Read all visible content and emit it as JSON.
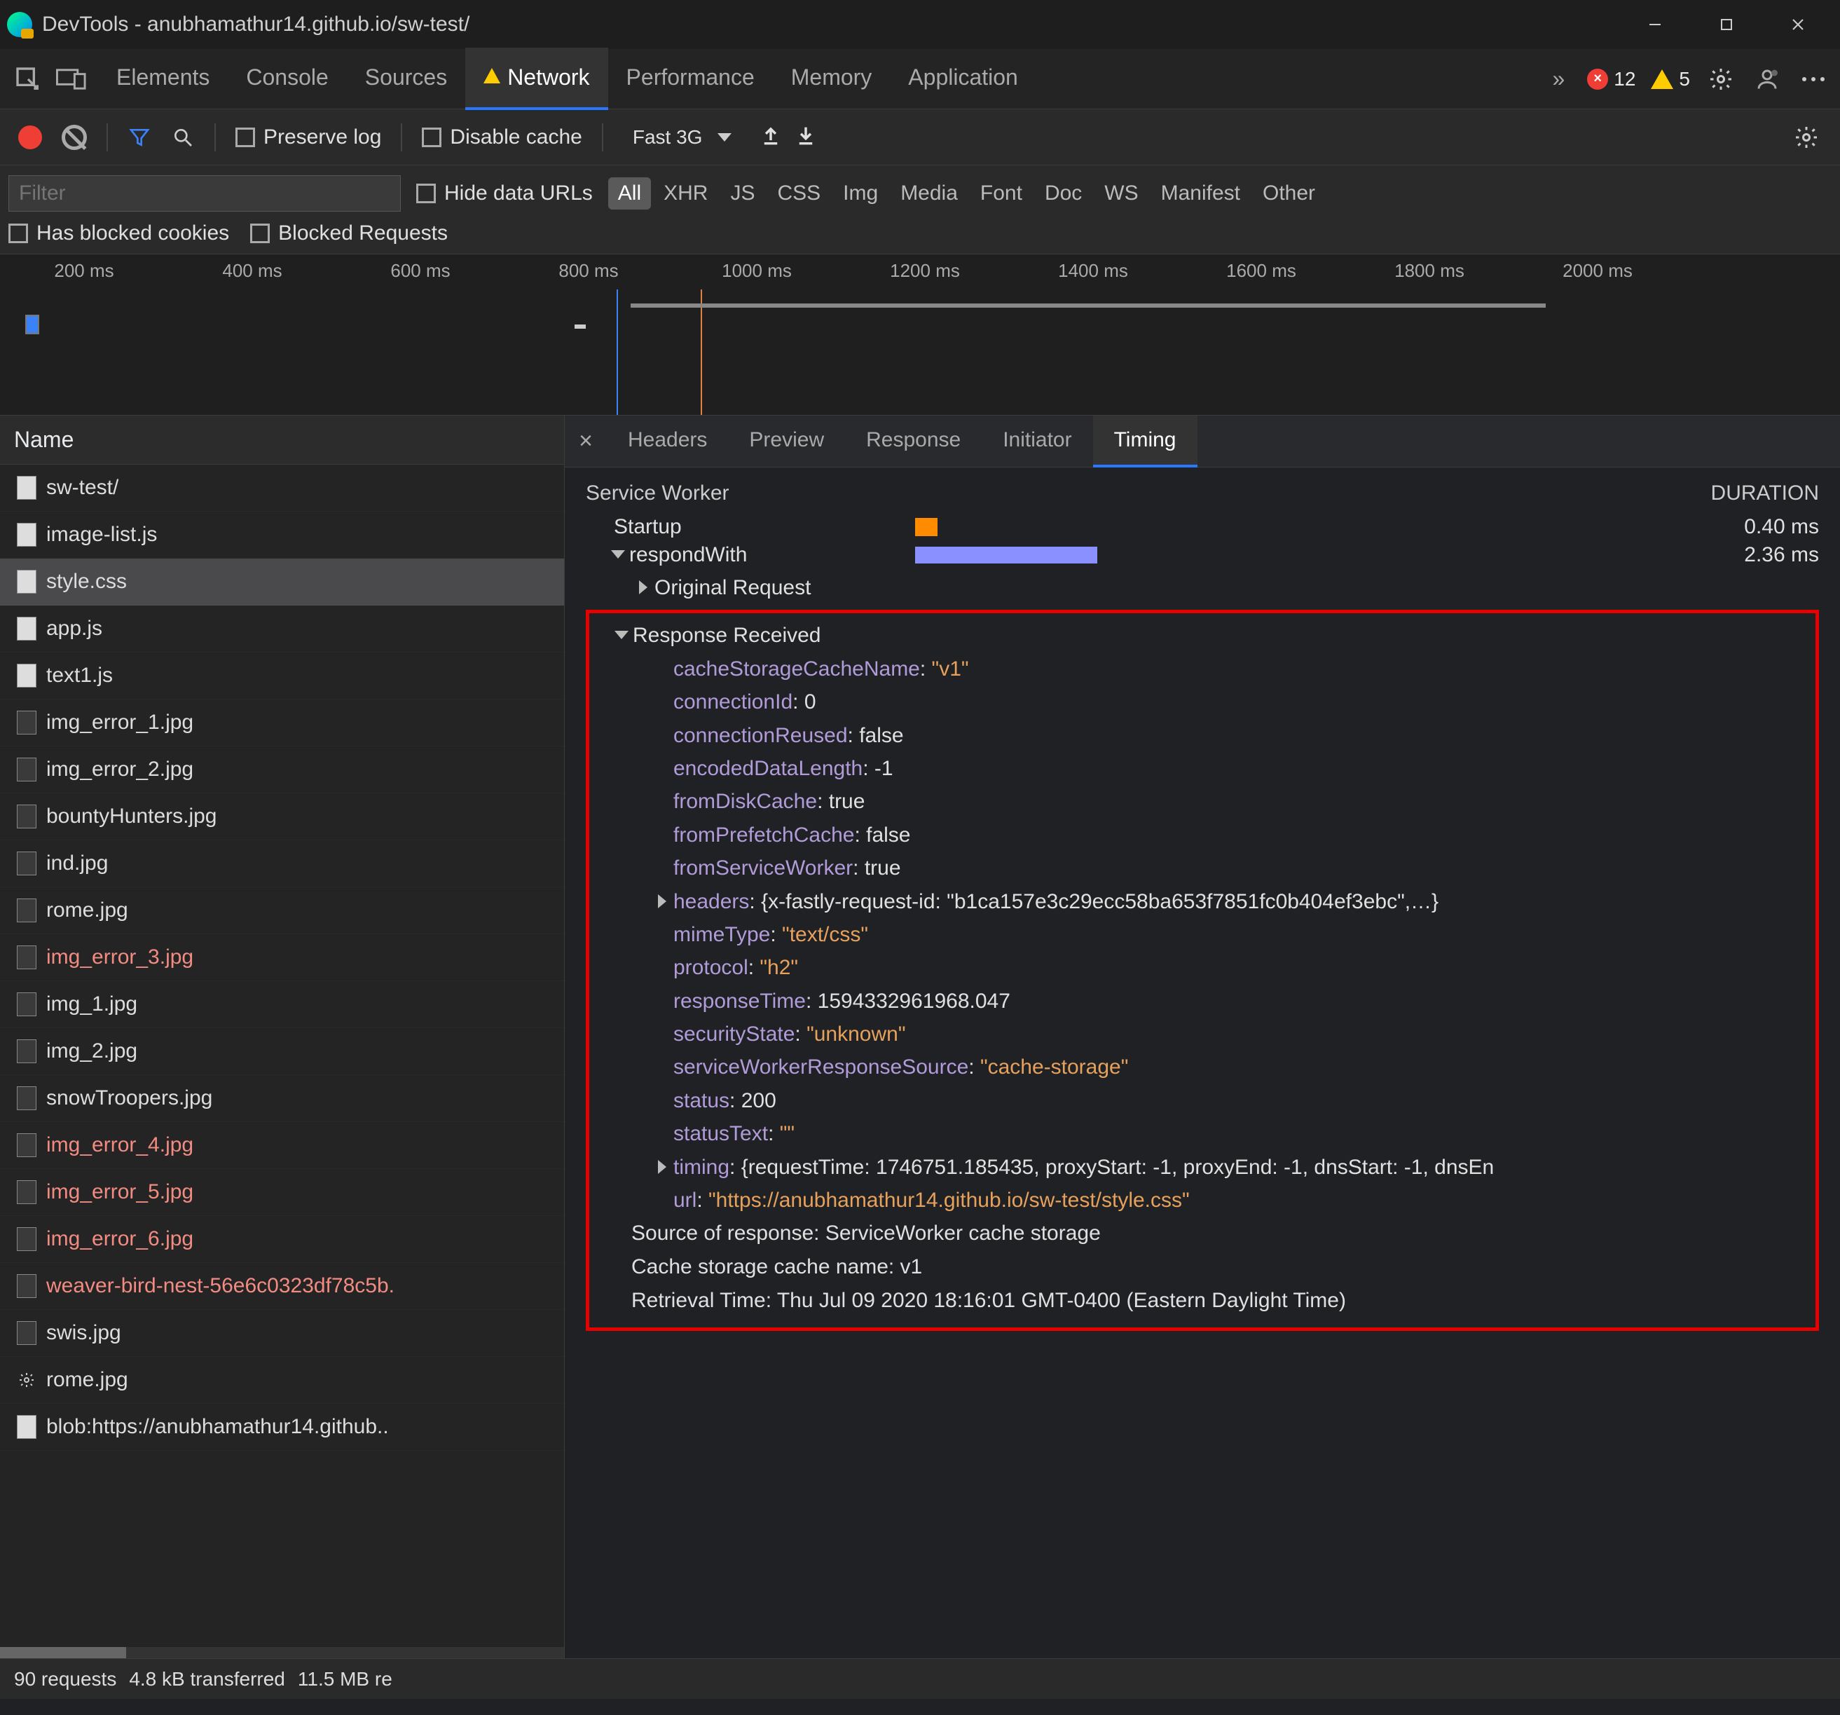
{
  "window": {
    "title": "DevTools - anubhamathur14.github.io/sw-test/"
  },
  "mainTabs": {
    "items": [
      "Elements",
      "Console",
      "Sources",
      "Network",
      "Performance",
      "Memory",
      "Application"
    ],
    "activeIndex": 3,
    "overflow": "»",
    "errors": "12",
    "warnings": "5"
  },
  "toolbar": {
    "preserveLog": "Preserve log",
    "disableCache": "Disable cache",
    "throttling": "Fast 3G"
  },
  "filterbar": {
    "placeholder": "Filter",
    "hideDataUrls": "Hide data URLs",
    "types": [
      "All",
      "XHR",
      "JS",
      "CSS",
      "Img",
      "Media",
      "Font",
      "Doc",
      "WS",
      "Manifest",
      "Other"
    ],
    "activeTypeIndex": 0,
    "hasBlockedCookies": "Has blocked cookies",
    "blockedRequests": "Blocked Requests"
  },
  "timeline": {
    "ticks": [
      "200 ms",
      "400 ms",
      "600 ms",
      "800 ms",
      "1000 ms",
      "1200 ms",
      "1400 ms",
      "1600 ms",
      "1800 ms",
      "2000 ms"
    ]
  },
  "requestList": {
    "header": "Name",
    "selectedIndex": 2,
    "items": [
      {
        "name": "sw-test/",
        "kind": "doc"
      },
      {
        "name": "image-list.js",
        "kind": "doc"
      },
      {
        "name": "style.css",
        "kind": "doc"
      },
      {
        "name": "app.js",
        "kind": "doc"
      },
      {
        "name": "text1.js",
        "kind": "doc"
      },
      {
        "name": "img_error_1.jpg",
        "kind": "img"
      },
      {
        "name": "img_error_2.jpg",
        "kind": "img"
      },
      {
        "name": "bountyHunters.jpg",
        "kind": "img"
      },
      {
        "name": "ind.jpg",
        "kind": "img"
      },
      {
        "name": "rome.jpg",
        "kind": "img"
      },
      {
        "name": "img_error_3.jpg",
        "kind": "img",
        "err": true
      },
      {
        "name": "img_1.jpg",
        "kind": "img"
      },
      {
        "name": "img_2.jpg",
        "kind": "img"
      },
      {
        "name": "snowTroopers.jpg",
        "kind": "img"
      },
      {
        "name": "img_error_4.jpg",
        "kind": "img",
        "err": true
      },
      {
        "name": "img_error_5.jpg",
        "kind": "img",
        "err": true
      },
      {
        "name": "img_error_6.jpg",
        "kind": "img",
        "err": true
      },
      {
        "name": "weaver-bird-nest-56e6c0323df78c5b.",
        "kind": "img",
        "err": true
      },
      {
        "name": "swis.jpg",
        "kind": "img"
      },
      {
        "name": "rome.jpg",
        "kind": "gear"
      },
      {
        "name": "blob:https://anubhamathur14.github..",
        "kind": "doc"
      }
    ]
  },
  "detailTabs": {
    "items": [
      "Headers",
      "Preview",
      "Response",
      "Initiator",
      "Timing"
    ],
    "activeIndex": 4
  },
  "timing": {
    "sectionTitle": "Service Worker",
    "durationHeader": "DURATION",
    "rows": [
      {
        "label": "Startup",
        "duration": "0.40 ms",
        "bar": "orange"
      },
      {
        "label": "respondWith",
        "duration": "2.36 ms",
        "bar": "purple",
        "expandable": true
      }
    ],
    "originalRequest": "Original Request",
    "responseReceived": {
      "title": "Response Received",
      "props": [
        {
          "k": "cacheStorageCacheName",
          "v": "\"v1\"",
          "str": true
        },
        {
          "k": "connectionId",
          "v": "0"
        },
        {
          "k": "connectionReused",
          "v": "false"
        },
        {
          "k": "encodedDataLength",
          "v": "-1"
        },
        {
          "k": "fromDiskCache",
          "v": "true"
        },
        {
          "k": "fromPrefetchCache",
          "v": "false"
        },
        {
          "k": "fromServiceWorker",
          "v": "true"
        },
        {
          "k": "headers",
          "v": "{x-fastly-request-id: \"b1ca157e3c29ecc58ba653f7851fc0b404ef3ebc\",…}",
          "expandable": true
        },
        {
          "k": "mimeType",
          "v": "\"text/css\"",
          "str": true
        },
        {
          "k": "protocol",
          "v": "\"h2\"",
          "str": true
        },
        {
          "k": "responseTime",
          "v": "1594332961968.047"
        },
        {
          "k": "securityState",
          "v": "\"unknown\"",
          "str": true
        },
        {
          "k": "serviceWorkerResponseSource",
          "v": "\"cache-storage\"",
          "str": true
        },
        {
          "k": "status",
          "v": "200"
        },
        {
          "k": "statusText",
          "v": "\"\"",
          "str": true
        },
        {
          "k": "timing",
          "v": "{requestTime: 1746751.185435, proxyStart: -1, proxyEnd: -1, dnsStart: -1, dnsEn",
          "expandable": true
        },
        {
          "k": "url",
          "v": "\"https://anubhamathur14.github.io/sw-test/style.css\"",
          "str": true
        }
      ],
      "summary": [
        "Source of response: ServiceWorker cache storage",
        "Cache storage cache name: v1",
        "Retrieval Time: Thu Jul 09 2020 18:16:01 GMT-0400 (Eastern Daylight Time)"
      ]
    }
  },
  "statusbar": {
    "requests": "90 requests",
    "transferred": "4.8 kB transferred",
    "resources": "11.5 MB re"
  }
}
